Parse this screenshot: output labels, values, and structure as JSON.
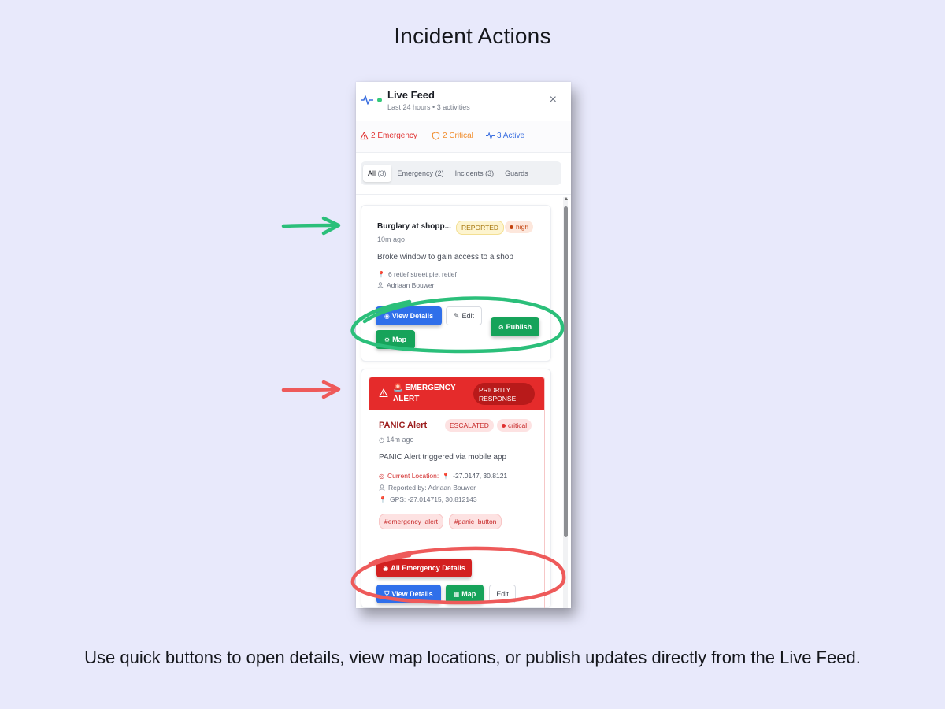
{
  "page": {
    "title": "Incident Actions",
    "caption": "Use quick buttons to open details, view map locations, or publish updates directly from the Live Feed."
  },
  "feed": {
    "title": "Live Feed",
    "subtitle": "Last 24 hours • 3 activities",
    "close_icon": "×"
  },
  "stats": {
    "emergency": "2 Emergency",
    "critical": "2 Critical",
    "active": "3 Active"
  },
  "tabs": [
    {
      "label": "All",
      "count": "(3)",
      "active": true
    },
    {
      "label": "Emergency",
      "count": "(2)",
      "active": false
    },
    {
      "label": "Incidents",
      "count": "(3)",
      "active": false
    },
    {
      "label": "Guards",
      "count": "",
      "active": false
    }
  ],
  "incident": {
    "title": "Burglary at shopp...",
    "status": "REPORTED",
    "severity": "high",
    "time": "10m ago",
    "description": "Broke window to gain access to a shop",
    "address": "6 retief street piet retief",
    "user": "Adriaan Bouwer",
    "buttons": {
      "view": "View Details",
      "edit": "Edit",
      "publish": "Publish",
      "map": "Map"
    }
  },
  "emergency": {
    "banner": "🚨 EMERGENCY ALERT",
    "priority": "PRIORITY RESPONSE",
    "title": "PANIC Alert",
    "status": "ESCALATED",
    "severity": "critical",
    "time": "14m ago",
    "description": "PANIC Alert triggered via mobile app",
    "location_label": "Current Location:",
    "location_coords": "-27.0147, 30.8121",
    "reported_by": "Reported by: Adriaan Bouwer",
    "gps": "GPS: -27.014715, 30.812143",
    "tags": [
      "#emergency_alert",
      "#panic_button"
    ],
    "buttons": {
      "all_details": "All Emergency Details",
      "view": "View Details",
      "map": "Map",
      "edit": "Edit"
    }
  },
  "colors": {
    "background": "#e8e9fb",
    "green_annotation": "#2bbf7a",
    "red_annotation": "#ee5a5a",
    "primary_blue": "#2f6fea",
    "success_green": "#16a35a",
    "danger_red": "#e52b2b"
  },
  "icons": {
    "feed": "activity-icon",
    "alert": "warning-triangle-icon",
    "shield": "shield-icon",
    "pin": "map-pin-icon",
    "user": "user-icon",
    "clock": "clock-icon"
  }
}
